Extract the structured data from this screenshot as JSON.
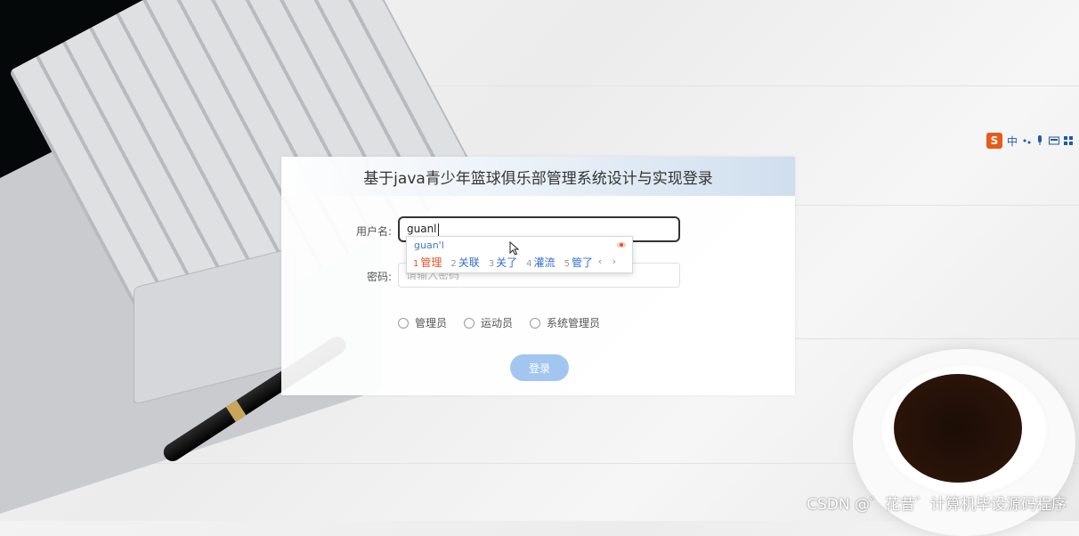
{
  "page": {
    "title": "基于java青少年篮球俱乐部管理系统设计与实现登录"
  },
  "form": {
    "username_label": "用户名:",
    "username_value": "guanl",
    "password_label": "密码:",
    "password_placeholder": "请输入密码",
    "roles": [
      "管理员",
      "运动员",
      "系统管理员"
    ],
    "login_button": "登录"
  },
  "ime": {
    "composition": "guan'l",
    "candidates": [
      {
        "n": "1",
        "text": "管理"
      },
      {
        "n": "2",
        "text": "关联"
      },
      {
        "n": "3",
        "text": "关了"
      },
      {
        "n": "4",
        "text": "灌流"
      },
      {
        "n": "5",
        "text": "管了"
      }
    ],
    "nav": "‹ ›"
  },
  "ime_toolbar": {
    "logo": "S",
    "mode": "中",
    "icons": [
      "punctuation-icon",
      "microphone-icon",
      "keyboard-icon",
      "grid-icon"
    ]
  },
  "watermark": "CSDN @゛花昔゛计算机毕设源码程序",
  "colors": {
    "primary_button": "#a3c6f1",
    "ime_candidate": "#2f6fcf",
    "ime_selected": "#e0532c",
    "sogou": "#e85a1b"
  }
}
